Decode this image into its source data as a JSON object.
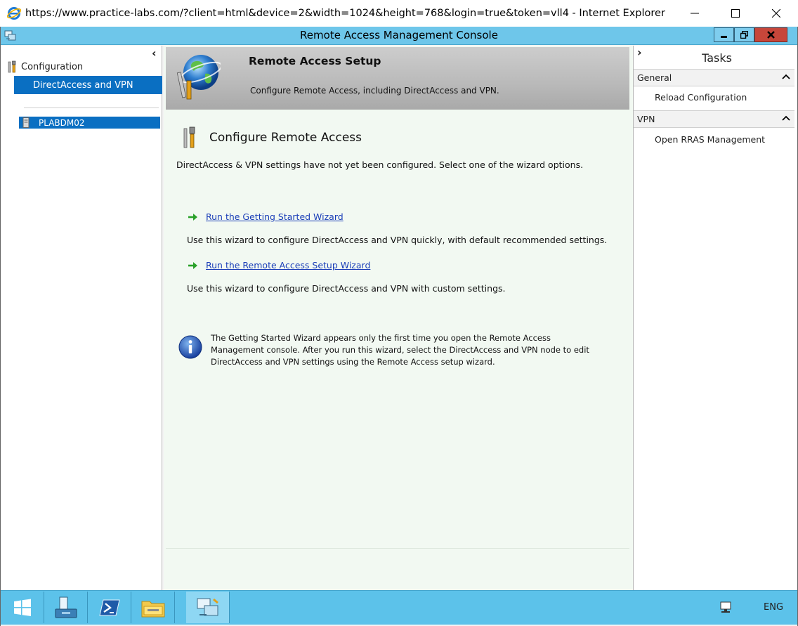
{
  "browser": {
    "title": "https://www.practice-labs.com/?client=html&device=2&width=1024&height=768&login=true&token=vll4 - Internet Explorer"
  },
  "mmc": {
    "title": "Remote Access Management Console"
  },
  "tree": {
    "configuration_label": "Configuration",
    "directaccess_label": "DirectAccess and VPN",
    "server_label": "PLABDM02"
  },
  "banner": {
    "title": "Remote Access Setup",
    "subtitle": "Configure Remote Access, including DirectAccess and VPN."
  },
  "main": {
    "section_title": "Configure Remote Access",
    "intro": "DirectAccess & VPN settings have not yet been configured. Select one of the wizard options.",
    "wizards": [
      {
        "link": "Run the Getting Started Wizard",
        "description": "Use this wizard to configure DirectAccess and VPN quickly, with default recommended settings."
      },
      {
        "link": "Run the Remote Access Setup Wizard",
        "description": "Use this wizard to configure DirectAccess and VPN with custom settings."
      }
    ],
    "info": "The Getting Started Wizard appears only the first time you open the Remote Access Management console. After you run this wizard, select the DirectAccess and VPN node to edit DirectAccess and VPN settings using the Remote Access setup wizard."
  },
  "tasks": {
    "title": "Tasks",
    "groups": [
      {
        "header": "General",
        "items": [
          "Reload Configuration"
        ]
      },
      {
        "header": "VPN",
        "items": [
          "Open RRAS Management"
        ]
      }
    ]
  },
  "taskbar": {
    "language": "ENG"
  },
  "colors": {
    "selection": "#0a6fc2",
    "mmc_titlebar": "#6ec6ea",
    "taskbar": "#5cc2ea",
    "link": "#1a3eb8"
  }
}
